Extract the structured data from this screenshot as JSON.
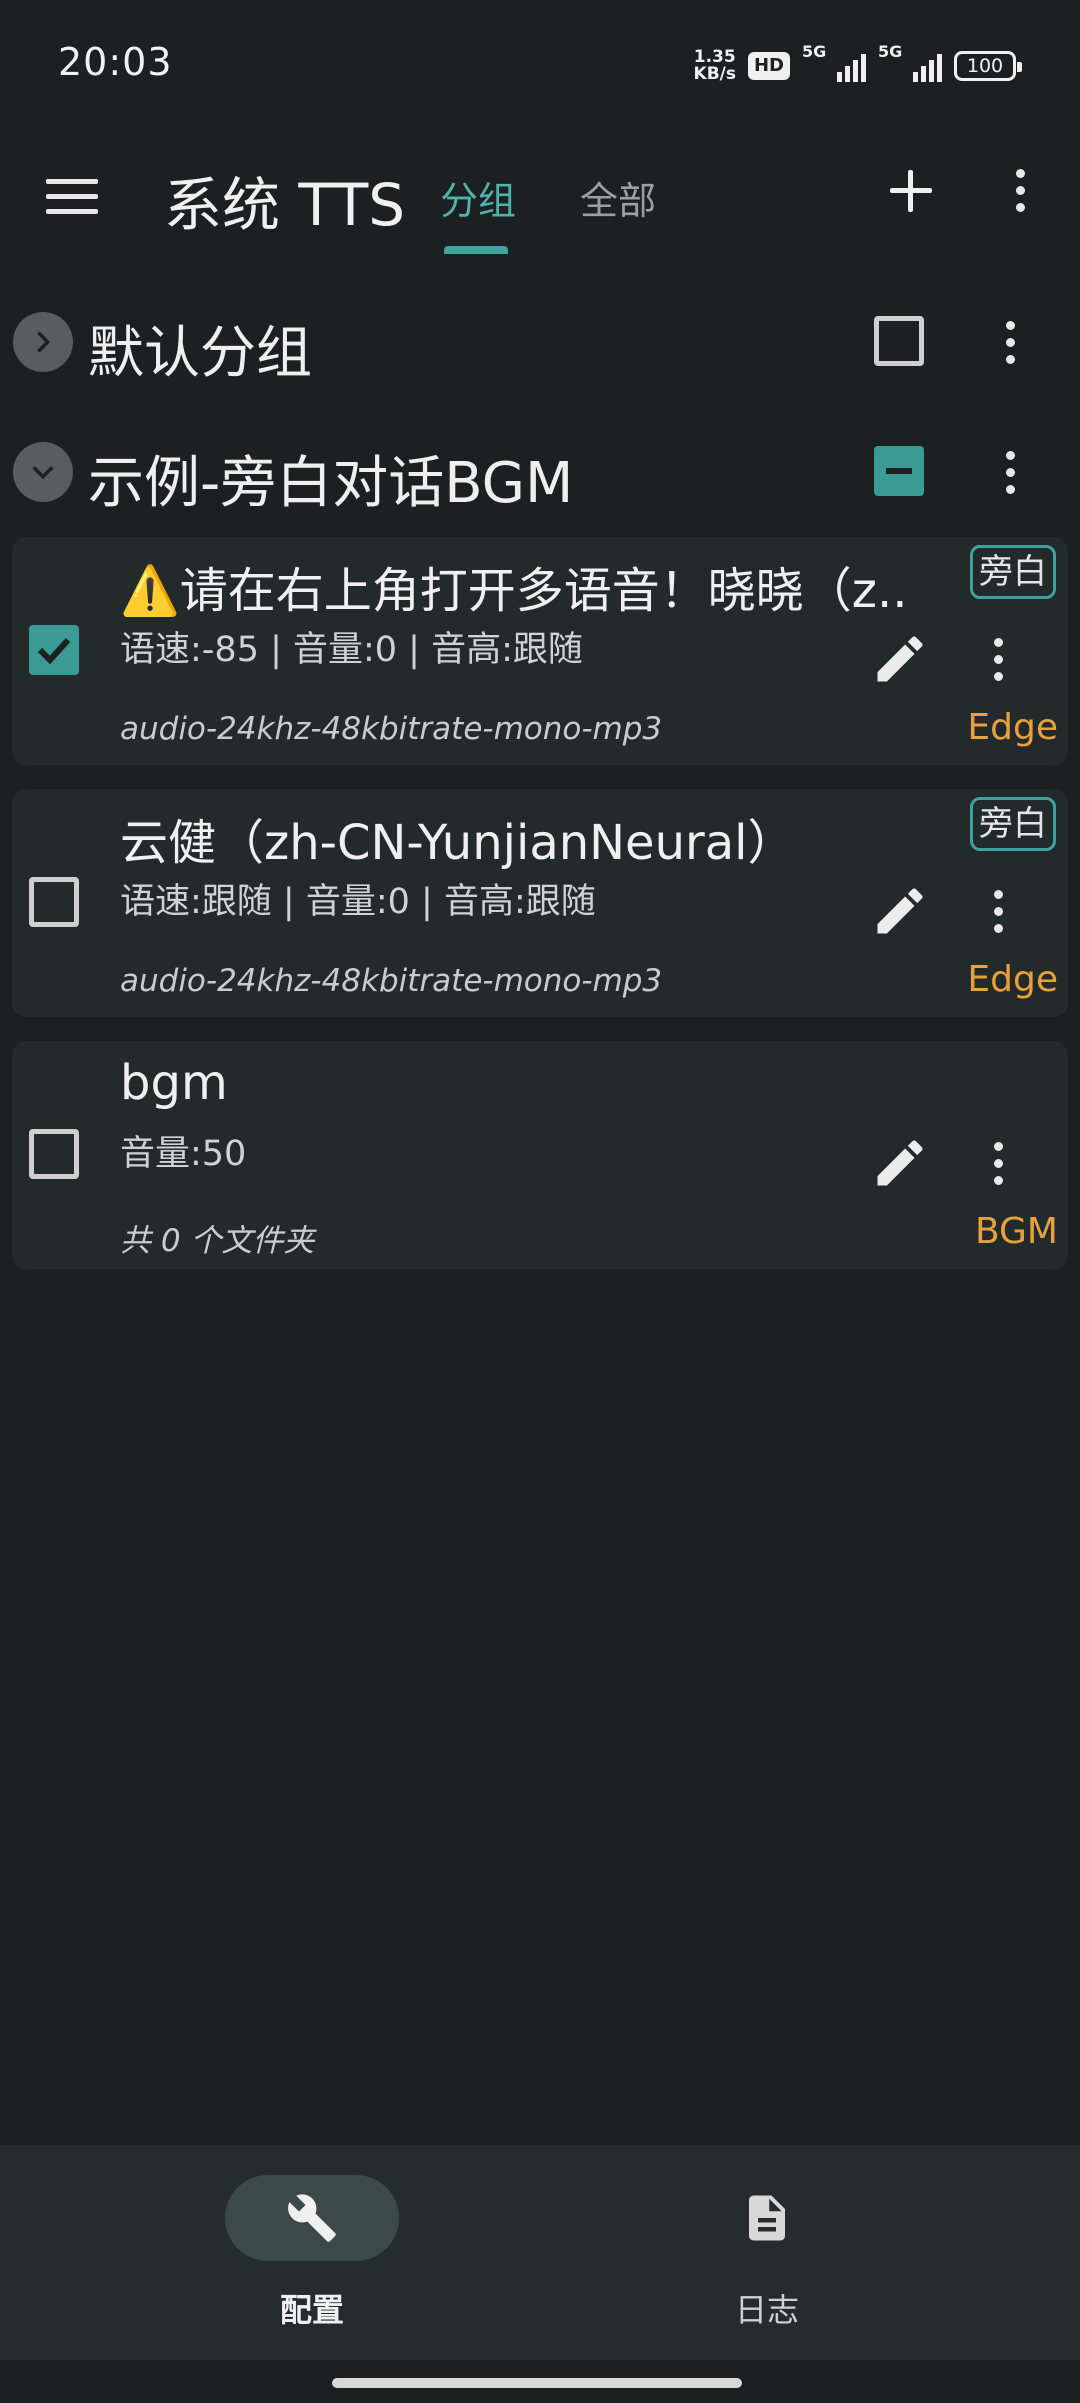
{
  "status_bar": {
    "time": "20:03",
    "net_speed_value": "1.35",
    "net_speed_unit": "KB/s",
    "hd_label": "HD",
    "signal_1_label": "5G",
    "signal_2_label": "5G",
    "battery": "100"
  },
  "app_bar": {
    "title": "系统 TTS",
    "tabs": [
      {
        "label": "分组",
        "selected": true
      },
      {
        "label": "全部",
        "selected": false
      }
    ]
  },
  "groups": [
    {
      "title": "默认分组",
      "expanded": false,
      "check_state": "unchecked"
    },
    {
      "title": "示例-旁白对话BGM",
      "expanded": true,
      "check_state": "indeterminate"
    }
  ],
  "items": [
    {
      "title": "⚠️请在右上角打开多语音！晓晓（z..",
      "subtitle": "语速:-85 | 音量:0 | 音高:跟随",
      "format": "audio-24khz-48kbitrate-mono-mp3",
      "tag": "旁白",
      "engine": "Edge",
      "checked": true
    },
    {
      "title": "云健（zh-CN-YunjianNeural）",
      "subtitle": "语速:跟随 | 音量:0 | 音高:跟随",
      "format": "audio-24khz-48kbitrate-mono-mp3",
      "tag": "旁白",
      "engine": "Edge",
      "checked": false
    },
    {
      "title": "bgm",
      "subtitle": "音量:50",
      "format": "共 0 个文件夹",
      "tag": "",
      "engine": "BGM",
      "checked": false
    }
  ],
  "bottom_nav": {
    "items": [
      {
        "label": "配置",
        "icon": "wrench-icon",
        "selected": true
      },
      {
        "label": "日志",
        "icon": "document-icon",
        "selected": false
      }
    ]
  },
  "colors": {
    "accent": "#3a9a94",
    "engine": "#e8a03c",
    "background": "#1d2020",
    "card": "#232a2b"
  }
}
